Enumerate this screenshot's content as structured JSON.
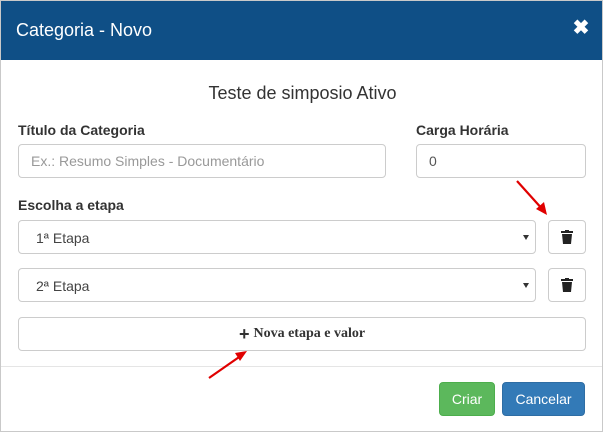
{
  "dialog": {
    "title": "Categoria - Novo",
    "close_glyph": "✖",
    "subtitle": "Teste de simposio Ativo"
  },
  "form": {
    "title_label": "Título da Categoria",
    "title_placeholder": "Ex.: Resumo Simples - Documentário",
    "title_value": "",
    "hours_label": "Carga Horária",
    "hours_value": "0",
    "stage_label": "Escolha a etapa",
    "stages": [
      {
        "value": "1ª Etapa"
      },
      {
        "value": "2ª Etapa"
      }
    ],
    "add_stage_icon": "+",
    "add_stage_label": "Nova etapa e valor"
  },
  "footer": {
    "save_label": "Criar",
    "cancel_label": "Cancelar"
  },
  "icons": {
    "close": "close-icon",
    "trash": "trash-icon",
    "plus": "plus-icon",
    "select_caret": "caret-down-icon",
    "annotation": "red-arrow-annotation"
  },
  "colors": {
    "header": "#0f4f86",
    "save": "#5cb85c",
    "cancel": "#337ab7",
    "annotation": "#e00000"
  }
}
